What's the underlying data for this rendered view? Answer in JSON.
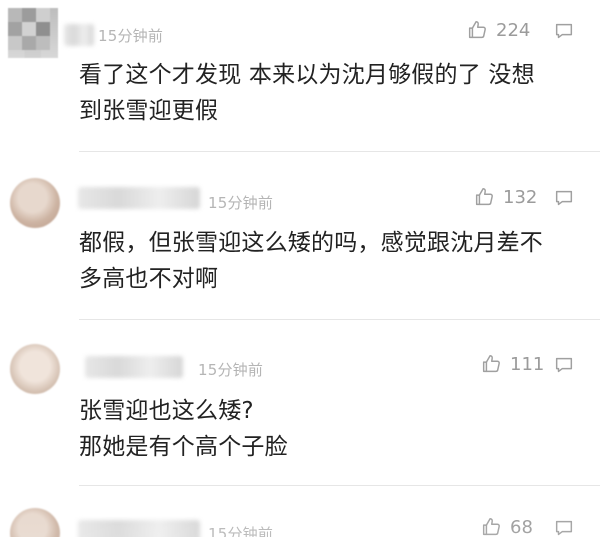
{
  "comments": [
    {
      "time": "15分钟前",
      "likes": "224",
      "text": "看了这个才发现 本来以为沈月够假的了 没想\n到张雪迎更假",
      "icons": {
        "like": "thumbs-up-icon",
        "reply": "speech-bubble-icon"
      }
    },
    {
      "time": "15分钟前",
      "likes": "132",
      "text": "都假，但张雪迎这么矮的吗，感觉跟沈月差不\n多高也不对啊",
      "icons": {
        "like": "thumbs-up-icon",
        "reply": "speech-bubble-icon"
      }
    },
    {
      "time": "15分钟前",
      "likes": "111",
      "text": "张雪迎也这么矮?\n那她是有个高个子脸",
      "icons": {
        "like": "thumbs-up-icon",
        "reply": "speech-bubble-icon"
      }
    },
    {
      "time": "15分钟前",
      "likes": "68",
      "text": "",
      "icons": {
        "like": "thumbs-up-icon",
        "reply": "speech-bubble-icon"
      }
    }
  ]
}
